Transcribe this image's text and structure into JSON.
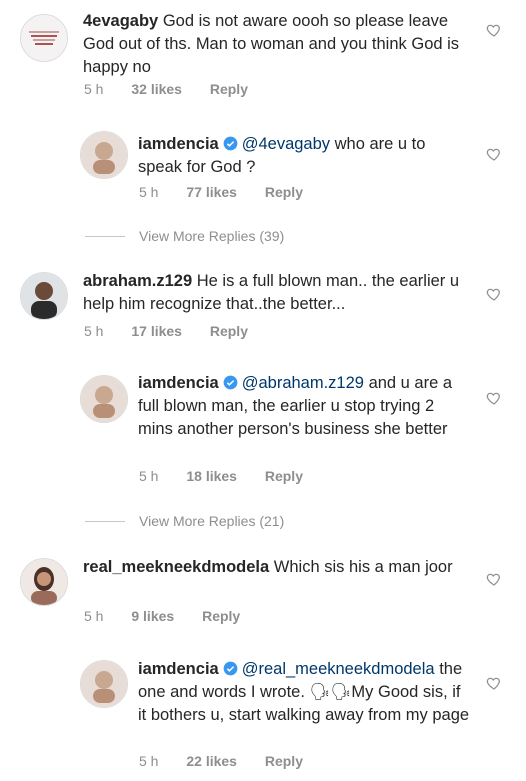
{
  "comments": [
    {
      "user": "4evagaby",
      "text": "God is not aware oooh so please leave God out of ths. Man to woman and you think God is happy no",
      "time": "5 h",
      "likes": "32 likes",
      "reply": "Reply",
      "avatar_text": "what is mine\nwill ...\nnot\ncome"
    },
    {
      "user": "iamdencia",
      "mention": "@4evagaby",
      "text": "who are u to speak for God ?",
      "time": "5 h",
      "likes": "77 likes",
      "reply": "Reply"
    },
    {
      "view_more": "View More Replies (39)"
    },
    {
      "user": "abraham.z129",
      "text": "He is a full blown man.. the earlier u help him recognize that..the better...",
      "time": "5 h",
      "likes": "17 likes",
      "reply": "Reply"
    },
    {
      "user": "iamdencia",
      "mention": "@abraham.z129",
      "text": "and u are a full blown man, the earlier u stop trying 2 mins another person's business she better",
      "time": "5 h",
      "likes": "18 likes",
      "reply": "Reply"
    },
    {
      "view_more": "View More Replies (21)"
    },
    {
      "user": "real_meekneekdmodela",
      "text": "Which sis his a man joor",
      "time": "5 h",
      "likes": "9 likes",
      "reply": "Reply"
    },
    {
      "user": "iamdencia",
      "mention": "@real_meekneekdmodela",
      "text": "the one and words I wrote. 🗣🗣My Good sis, if it bothers u, start walking away from my page",
      "time": "5 h",
      "likes": "22 likes",
      "reply": "Reply"
    }
  ],
  "colors": {
    "verified": "#3897f0",
    "mention": "#00376b",
    "meta": "#8e8e8e"
  }
}
